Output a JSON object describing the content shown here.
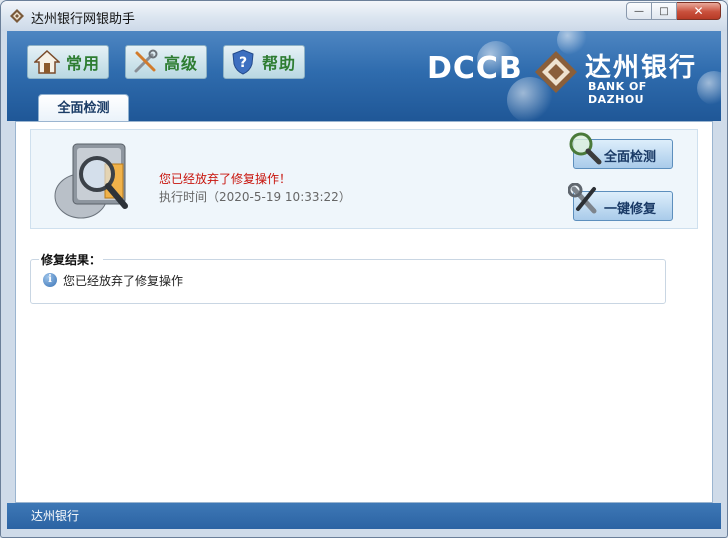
{
  "window": {
    "title": "达州银行网银助手",
    "buttons": {
      "minimize": "—",
      "maximize": "□",
      "close": "✕"
    }
  },
  "nav": [
    {
      "label": "常用",
      "icon": "home-icon"
    },
    {
      "label": "高级",
      "icon": "tools-icon"
    },
    {
      "label": "帮助",
      "icon": "help-shield-icon"
    }
  ],
  "logo": {
    "text": "DCCB",
    "name_cn": "达州银行",
    "name_en": "BANK OF DAZHOU"
  },
  "tab": {
    "label": "全面检测"
  },
  "scan": {
    "message": "您已经放弃了修复操作！",
    "time_text": "执行时间（2020-5-19 10:33:22）",
    "detect_button": "全面检测",
    "repair_button": "一键修复"
  },
  "results": {
    "title": "修复结果：",
    "item": "您已经放弃了修复操作"
  },
  "status": {
    "text": "达州银行"
  },
  "colors": {
    "accent_blue": "#2f6cae",
    "nav_text_green": "#2e7d32",
    "message_red": "#c8140c"
  }
}
